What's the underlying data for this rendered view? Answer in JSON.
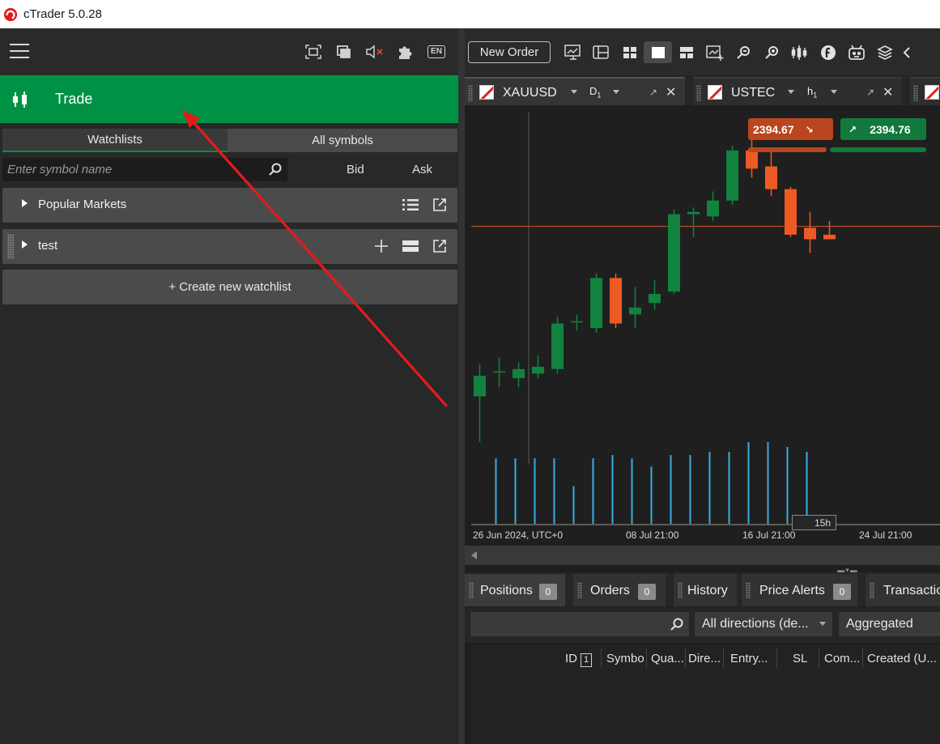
{
  "window": {
    "title": "cTrader 5.0.28"
  },
  "left_panel": {
    "header_icons": [
      "fullscreen-icon",
      "detach-window-icon",
      "mute-icon",
      "plugin-icon"
    ],
    "language_badge": "EN",
    "section": {
      "label": "Trade"
    },
    "tabs": [
      {
        "label": "Watchlists",
        "active": true
      },
      {
        "label": "All symbols",
        "active": false
      }
    ],
    "search": {
      "placeholder": "Enter symbol name",
      "value": ""
    },
    "columns": {
      "bid": "Bid",
      "ask": "Ask"
    },
    "watchlists": [
      {
        "name": "Popular Markets",
        "actions": [
          "list-icon",
          "open-external-icon"
        ]
      },
      {
        "name": "test",
        "actions": [
          "add-icon",
          "layout-icon",
          "open-external-icon"
        ]
      }
    ],
    "create_label": "+ Create new watchlist"
  },
  "toolbar": {
    "new_order_label": "New Order",
    "icons": [
      "chart-settings-icon",
      "chart-layout-icon",
      "grid-layout-icon",
      "single-chart-icon",
      "split-chart-icon",
      "add-chart-icon",
      "zoom-out-icon",
      "zoom-in-icon",
      "indicators-icon",
      "cbot-icon",
      "robot-icon",
      "layers-icon",
      "collapse-icon"
    ],
    "active_icon": "single-chart-icon"
  },
  "chart_tabs": [
    {
      "symbol": "XAUUSD",
      "timeframe": "D",
      "timeframe_sub": "1",
      "active": true
    },
    {
      "symbol": "USTEC",
      "timeframe": "h",
      "timeframe_sub": "1",
      "active": false
    }
  ],
  "chart": {
    "sell_price": "2394.67",
    "buy_price": "2394.76",
    "cursor_label": "15h",
    "x_labels": [
      "26 Jun 2024, UTC+0",
      "08 Jul 21:00",
      "16 Jul 21:00",
      "24 Jul 21:00"
    ],
    "colors": {
      "bull": "#12833f",
      "bear": "#ee5a24",
      "volume": "#3aaee0",
      "price_line": "#d9532a"
    }
  },
  "chart_data": {
    "type": "candlestick",
    "ohlc": [
      {
        "o": 2320,
        "h": 2334,
        "l": 2300,
        "c": 2329
      },
      {
        "o": 2331,
        "h": 2337,
        "l": 2324,
        "c": 2331
      },
      {
        "o": 2328,
        "h": 2335,
        "l": 2324,
        "c": 2332
      },
      {
        "o": 2330,
        "h": 2338,
        "l": 2328,
        "c": 2333
      },
      {
        "o": 2332,
        "h": 2355,
        "l": 2330,
        "c": 2352
      },
      {
        "o": 2353,
        "h": 2356,
        "l": 2349,
        "c": 2353
      },
      {
        "o": 2350,
        "h": 2374,
        "l": 2348,
        "c": 2372
      },
      {
        "o": 2372,
        "h": 2374,
        "l": 2350,
        "c": 2352
      },
      {
        "o": 2356,
        "h": 2368,
        "l": 2350,
        "c": 2359
      },
      {
        "o": 2361,
        "h": 2371,
        "l": 2358,
        "c": 2365
      },
      {
        "o": 2366,
        "h": 2402,
        "l": 2365,
        "c": 2400
      },
      {
        "o": 2400,
        "h": 2403,
        "l": 2390,
        "c": 2401
      },
      {
        "o": 2399,
        "h": 2410,
        "l": 2397,
        "c": 2406
      },
      {
        "o": 2406,
        "h": 2430,
        "l": 2404,
        "c": 2428
      },
      {
        "o": 2428,
        "h": 2436,
        "l": 2416,
        "c": 2420
      },
      {
        "o": 2421,
        "h": 2428,
        "l": 2408,
        "c": 2411
      },
      {
        "o": 2411,
        "h": 2412,
        "l": 2390,
        "c": 2391
      },
      {
        "o": 2394,
        "h": 2401,
        "l": 2383,
        "c": 2389
      },
      {
        "o": 2391,
        "h": 2397,
        "l": 2389,
        "c": 2389
      }
    ],
    "volume": [
      40,
      40,
      40,
      40,
      23,
      40,
      42,
      40,
      35,
      42,
      42,
      44,
      44,
      50,
      50,
      47,
      44
    ],
    "current_price": 2394.67,
    "ylim": [
      2290,
      2445
    ],
    "volume_max": 50
  },
  "bottom_tabs": [
    {
      "label": "Positions",
      "count": "0",
      "active": true
    },
    {
      "label": "Orders",
      "count": "0",
      "active": false
    },
    {
      "label": "History",
      "count": null,
      "active": false
    },
    {
      "label": "Price Alerts",
      "count": "0",
      "active": false
    },
    {
      "label": "Transactio",
      "count": null,
      "active": false
    }
  ],
  "filters": {
    "search_value": "",
    "direction": "All directions (de...",
    "grouping": "Aggregated"
  },
  "positions_columns": {
    "id": "ID",
    "id_badge": "1",
    "symbol": "Symbo",
    "quantity": "Qua...",
    "direction": "Dire...",
    "entry": "Entry...",
    "sl": "SL",
    "commission": "Com...",
    "created": "Created (U..."
  }
}
